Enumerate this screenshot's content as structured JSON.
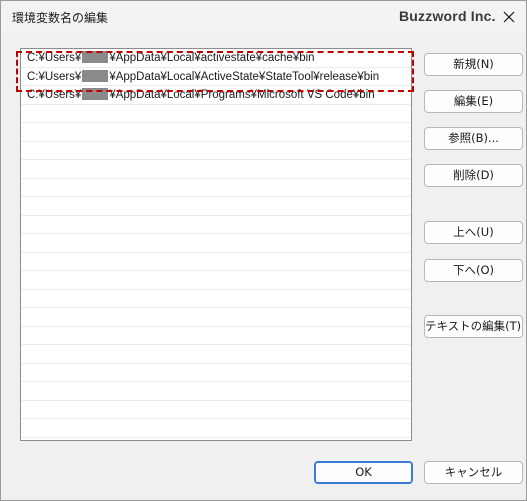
{
  "window": {
    "title": "環境変数名の編集",
    "brand": "Buzzword Inc."
  },
  "icons": {
    "close": "close-icon"
  },
  "list": {
    "items": [
      {
        "prefix": "C:¥Users¥",
        "suffix": "¥AppData¥Local¥activestate¥cache¥bin"
      },
      {
        "prefix": "C:¥Users¥",
        "suffix": "¥AppData¥Local¥ActiveState¥StateTool¥release¥bin"
      },
      {
        "prefix": "C:¥Users¥",
        "suffix": "¥AppData¥Local¥Programs¥Microsoft VS Code¥bin"
      }
    ],
    "empty_rows": 18
  },
  "buttons": {
    "new": "新規(N)",
    "edit": "編集(E)",
    "browse": "参照(B)...",
    "delete": "削除(D)",
    "move_up": "上へ(U)",
    "move_down": "下へ(O)",
    "edit_text": "テキストの編集(T)...",
    "ok": "OK",
    "cancel": "キャンセル"
  },
  "colors": {
    "highlight": "#c00000",
    "ok_border": "#3a7bd5"
  }
}
